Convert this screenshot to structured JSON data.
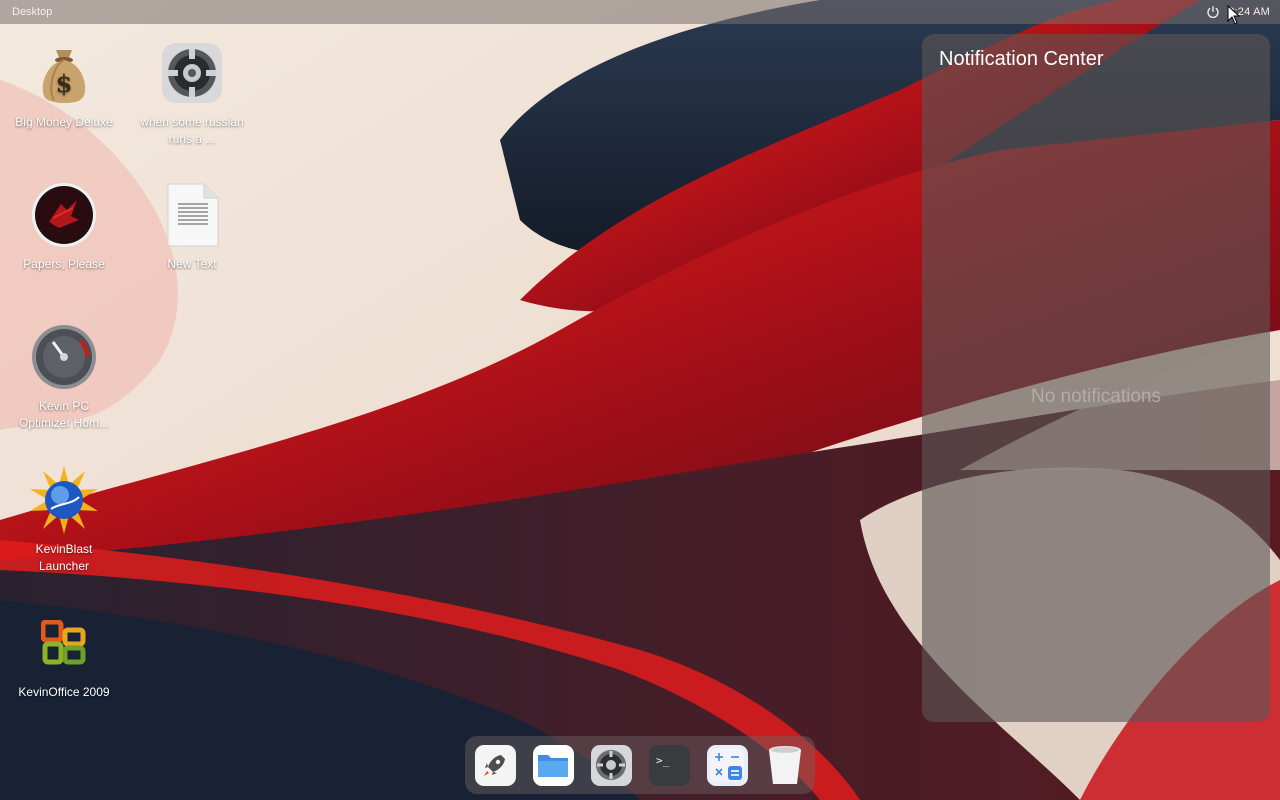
{
  "topbar": {
    "title": "Desktop",
    "clock": "8:24 AM",
    "power_icon": "power-icon"
  },
  "desktop_icons": [
    {
      "label": "Big Money Deluxe",
      "icon": "money-bag-icon"
    },
    {
      "label": "when some russian runs a ...",
      "icon": "settings-gear-icon"
    },
    {
      "label": "Papers, Please",
      "icon": "papers-please-icon"
    },
    {
      "label": "New Text",
      "icon": "text-document-icon"
    },
    {
      "label": "Kevin PC Optimizer Hom...",
      "icon": "gauge-icon"
    },
    {
      "label": "KevinBlast Launcher",
      "icon": "globe-burst-icon"
    },
    {
      "label": "KevinOffice 2009",
      "icon": "office-logo-icon"
    }
  ],
  "notification_center": {
    "title": "Notification Center",
    "empty_text": "No notifications"
  },
  "dock": {
    "items": [
      {
        "name": "launcher",
        "icon": "rocket-icon"
      },
      {
        "name": "files",
        "icon": "folder-icon"
      },
      {
        "name": "settings",
        "icon": "gear-icon"
      },
      {
        "name": "terminal",
        "icon": "terminal-icon"
      },
      {
        "name": "calculator",
        "icon": "calculator-icon"
      },
      {
        "name": "trash",
        "icon": "trash-icon"
      }
    ]
  },
  "colors": {
    "accent_red": "#d41a1a",
    "navy": "#1f2a3c",
    "cream": "#efe3d6"
  }
}
